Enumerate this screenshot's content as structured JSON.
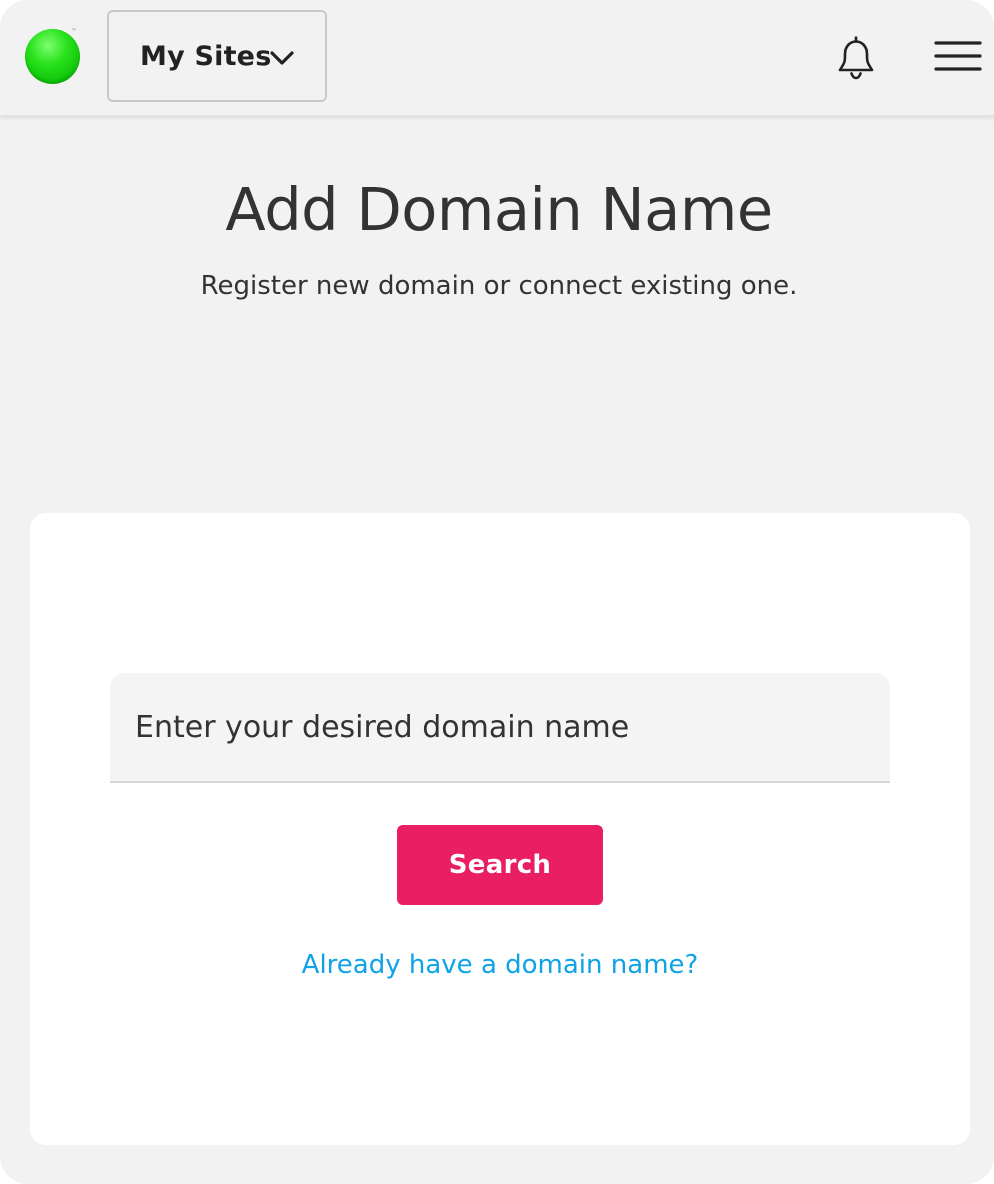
{
  "header": {
    "logo_mark": "™",
    "site_selector_label": "My Sites",
    "icons": {
      "logo": "green-circle-logo",
      "dropdown": "chevron-down-icon",
      "notifications": "bell-icon",
      "menu": "hamburger-menu-icon"
    }
  },
  "main": {
    "title": "Add Domain Name",
    "subtitle": "Register new domain or connect existing one."
  },
  "card": {
    "domain_input": {
      "value": "",
      "placeholder": "Enter your desired domain name"
    },
    "search_label": "Search",
    "existing_domain_link": "Already have a domain name?"
  },
  "colors": {
    "page_background": "#f2f2f2",
    "card_background": "#ffffff",
    "logo_green": "#11c80a",
    "search_button": "#e91e63",
    "link": "#0fa3e6",
    "text": "#333333"
  }
}
